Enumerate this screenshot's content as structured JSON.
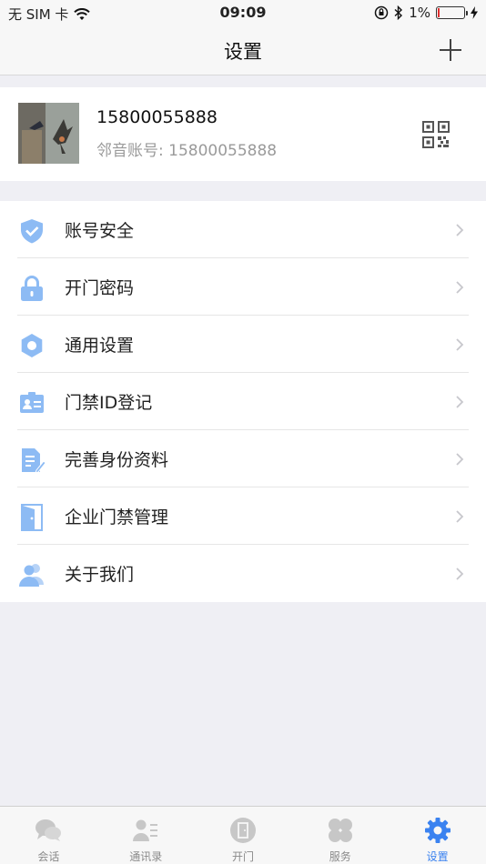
{
  "status_bar": {
    "carrier": "无 SIM 卡",
    "time": "09:09",
    "battery_percent": "1%",
    "battery_level": 0.01
  },
  "nav": {
    "title": "设置",
    "add_icon": "plus-icon"
  },
  "profile": {
    "phone": "15800055888",
    "account_line": "邻音账号: 15800055888",
    "qr_icon": "qr-code-icon"
  },
  "menu": [
    {
      "label": "账号安全",
      "icon": "shield-check-icon"
    },
    {
      "label": "开门密码",
      "icon": "lock-icon"
    },
    {
      "label": "通用设置",
      "icon": "gear-icon"
    },
    {
      "label": "门禁ID登记",
      "icon": "id-card-icon"
    },
    {
      "label": "完善身份资料",
      "icon": "document-edit-icon"
    },
    {
      "label": "企业门禁管理",
      "icon": "door-icon"
    },
    {
      "label": "关于我们",
      "icon": "people-icon"
    }
  ],
  "tabs": [
    {
      "label": "会话",
      "icon": "chat-bubbles-icon",
      "active": false
    },
    {
      "label": "通讯录",
      "icon": "contacts-icon",
      "active": false
    },
    {
      "label": "开门",
      "icon": "open-door-icon",
      "active": false
    },
    {
      "label": "服务",
      "icon": "services-icon",
      "active": false
    },
    {
      "label": "设置",
      "icon": "gear-icon",
      "active": true
    }
  ],
  "colors": {
    "accent": "#3a82f0",
    "icon_blue": "#9dc3f7",
    "background": "#efeff4",
    "tab_inactive": "#c7c7c7"
  }
}
